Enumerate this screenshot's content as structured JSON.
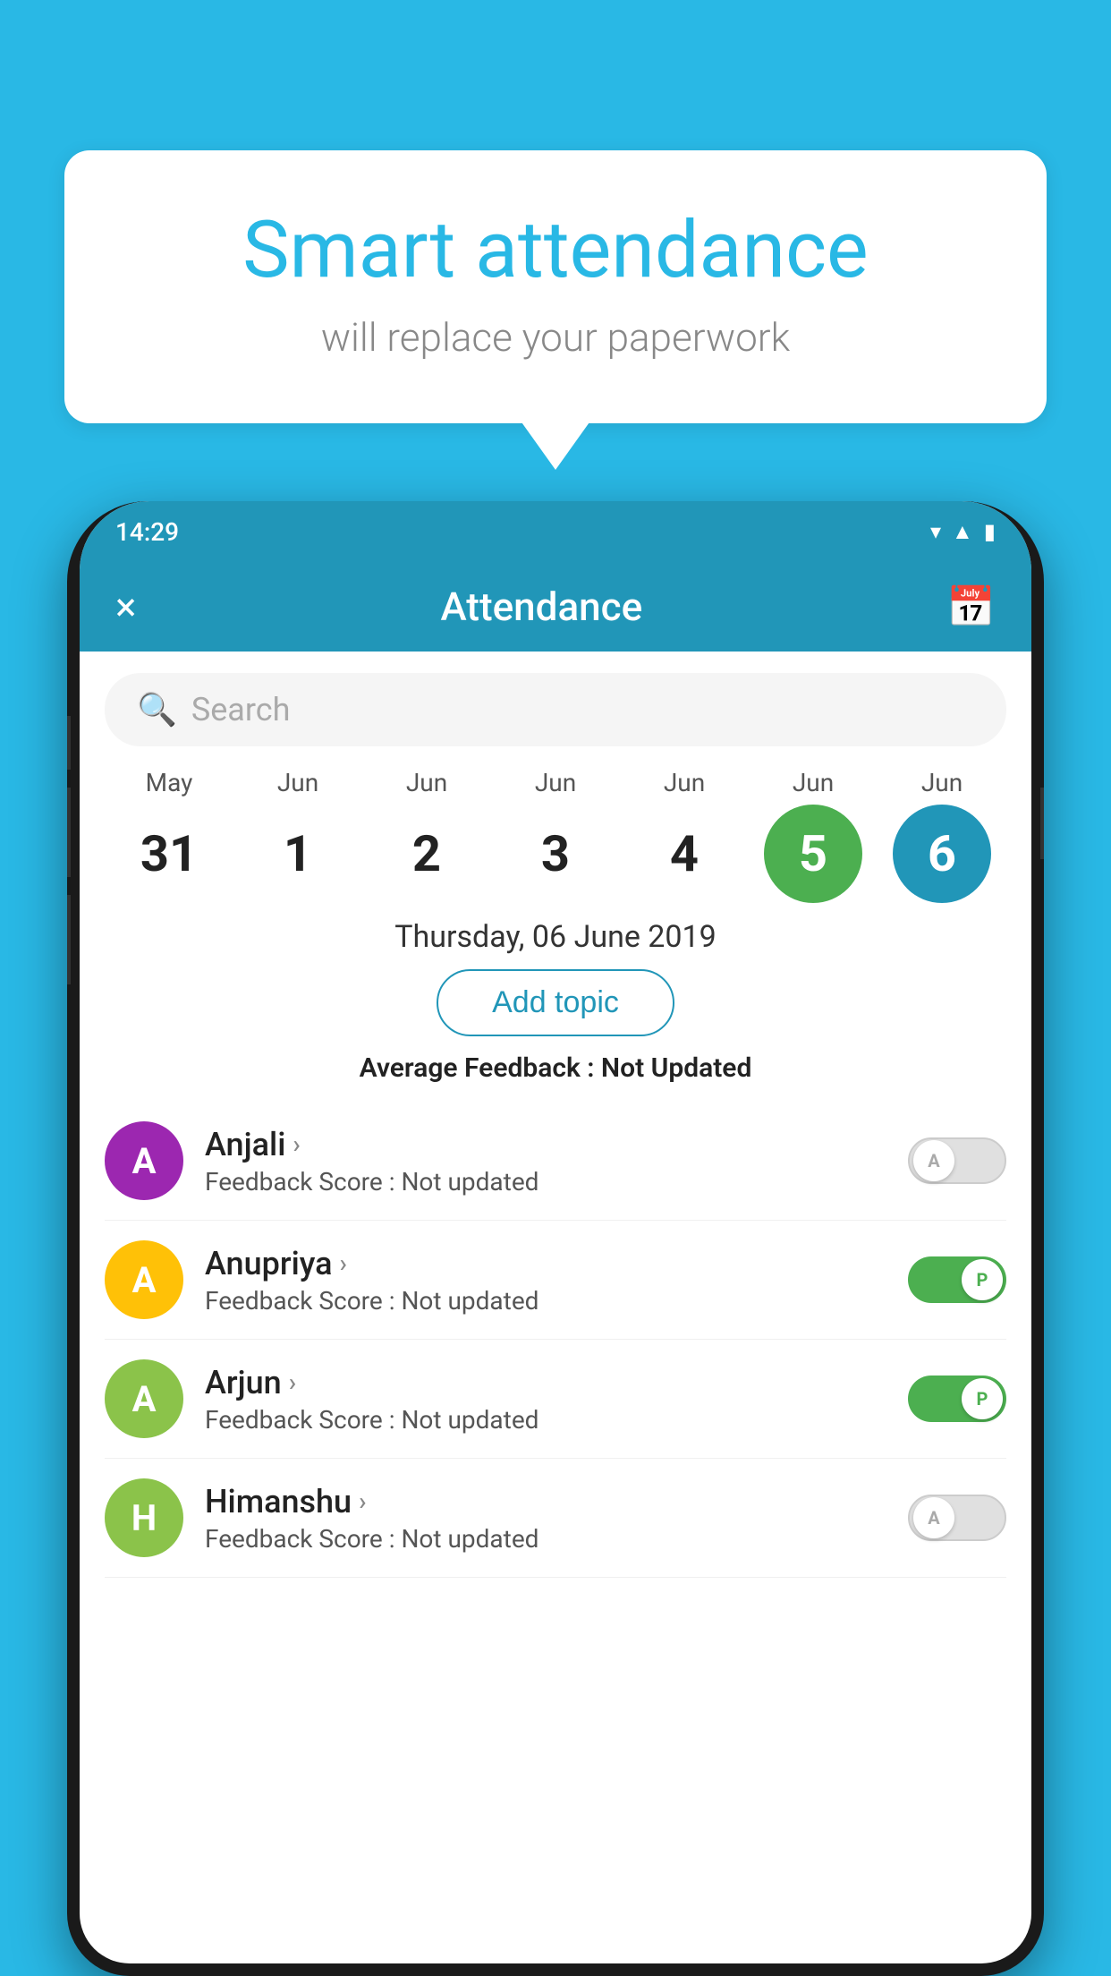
{
  "background_color": "#29b8e5",
  "bubble": {
    "title": "Smart attendance",
    "subtitle": "will replace your paperwork"
  },
  "phone": {
    "status_bar": {
      "time": "14:29",
      "icons": [
        "wifi",
        "signal",
        "battery"
      ]
    },
    "header": {
      "title": "Attendance",
      "close_label": "×",
      "calendar_icon": "calendar"
    },
    "search": {
      "placeholder": "Search"
    },
    "dates": [
      {
        "month": "May",
        "day": "31",
        "selected": false
      },
      {
        "month": "Jun",
        "day": "1",
        "selected": false
      },
      {
        "month": "Jun",
        "day": "2",
        "selected": false
      },
      {
        "month": "Jun",
        "day": "3",
        "selected": false
      },
      {
        "month": "Jun",
        "day": "4",
        "selected": false
      },
      {
        "month": "Jun",
        "day": "5",
        "selected": "green"
      },
      {
        "month": "Jun",
        "day": "6",
        "selected": "blue"
      }
    ],
    "selected_date": "Thursday, 06 June 2019",
    "add_topic_label": "Add topic",
    "avg_feedback_label": "Average Feedback :",
    "avg_feedback_value": "Not Updated",
    "students": [
      {
        "name": "Anjali",
        "avatar_letter": "A",
        "avatar_color": "#9c27b0",
        "feedback_label": "Feedback Score :",
        "feedback_value": "Not updated",
        "toggle_state": "off",
        "toggle_label": "A"
      },
      {
        "name": "Anupriya",
        "avatar_letter": "A",
        "avatar_color": "#ffc107",
        "feedback_label": "Feedback Score :",
        "feedback_value": "Not updated",
        "toggle_state": "on",
        "toggle_label": "P"
      },
      {
        "name": "Arjun",
        "avatar_letter": "A",
        "avatar_color": "#8bc34a",
        "feedback_label": "Feedback Score :",
        "feedback_value": "Not updated",
        "toggle_state": "on",
        "toggle_label": "P"
      },
      {
        "name": "Himanshu",
        "avatar_letter": "H",
        "avatar_color": "#8bc34a",
        "feedback_label": "Feedback Score :",
        "feedback_value": "Not updated",
        "toggle_state": "off",
        "toggle_label": "A"
      }
    ]
  }
}
